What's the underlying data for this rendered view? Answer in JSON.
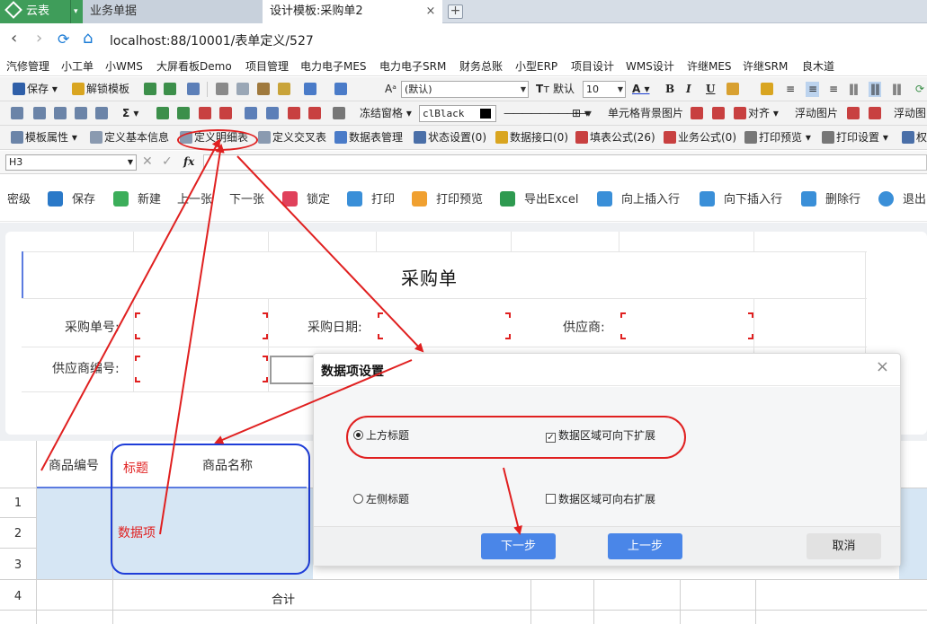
{
  "tabs": {
    "app_name": "云表",
    "menu_glyph": "▾",
    "biz": "业务单据",
    "active": "设计模板:采购单2",
    "close": "×",
    "add": "+"
  },
  "address": {
    "back": "‹",
    "forward": "›",
    "refresh": "⟳",
    "home": "⌂",
    "url": "localhost:88/10001/表单定义/527"
  },
  "bookmarks": [
    "汽修管理",
    "小工单",
    "小WMS",
    "大屏看板Demo",
    "项目管理",
    "电力电子MES",
    "电力电子SRM",
    "财务总账",
    "小型ERP",
    "项目设计",
    "WMS设计",
    "许继MES",
    "许继SRM",
    "良木道"
  ],
  "toolbar1": {
    "save": "保存",
    "unlock": "解锁模板",
    "font_name": "(默认)",
    "font_style": "默认",
    "font_size": "10",
    "bold": "B",
    "italic": "I",
    "underline": "U"
  },
  "toolbar2": {
    "sigma": "Σ",
    "freeze": "冻结窗格",
    "color_name": "clBlack",
    "cell_bg_image": "单元格背景图片",
    "align": "对齐",
    "float_image": "浮动图片",
    "float_image2": "浮动图"
  },
  "toolbar3": {
    "template_props": "模板属性",
    "define_basic": "定义基本信息",
    "define_detail": "定义明细表",
    "define_cross": "定义交叉表",
    "table_mgmt": "数据表管理",
    "state_settings": "状态设置(0)",
    "data_interface": "数据接口(0)",
    "fill_formula": "填表公式(26)",
    "biz_formula": "业务公式(0)",
    "print_preview": "打印预览",
    "print_settings": "打印设置",
    "perm": "权"
  },
  "formula_bar": {
    "cell_ref": "H3",
    "cancel": "✕",
    "confirm": "✓",
    "fx": "fx"
  },
  "actions": [
    "密级",
    "保存",
    "新建",
    "上一张",
    "下一张",
    "锁定",
    "打印",
    "打印预览",
    "导出Excel",
    "向上插入行",
    "向下插入行",
    "删除行",
    "退出"
  ],
  "form": {
    "title": "采购单",
    "po_no": "采购单号:",
    "po_date": "采购日期:",
    "supplier": "供应商:",
    "supplier_no": "供应商编号:"
  },
  "grid": {
    "col_product_code": "商品编号",
    "col_product_name": "商品名称",
    "rows": [
      "1",
      "2",
      "3",
      "4"
    ],
    "total": "合计"
  },
  "annotations": {
    "title_label": "标题",
    "data_item_label": "数据项"
  },
  "dialog": {
    "title": "数据项设置",
    "close": "×",
    "opt_top_title": "上方标题",
    "opt_left_title": "左侧标题",
    "opt_expand_down": "数据区域可向下扩展",
    "opt_expand_right": "数据区域可向右扩展",
    "btn_next": "下一步",
    "btn_prev": "上一步",
    "btn_cancel": "取消"
  },
  "colors": {
    "accent_green": "#3f9d5a",
    "annotation_red": "#e02020",
    "annotation_blue": "#1e3dd8",
    "button_blue": "#4a86e8",
    "detail_cell_blue": "#d6e6f4"
  }
}
